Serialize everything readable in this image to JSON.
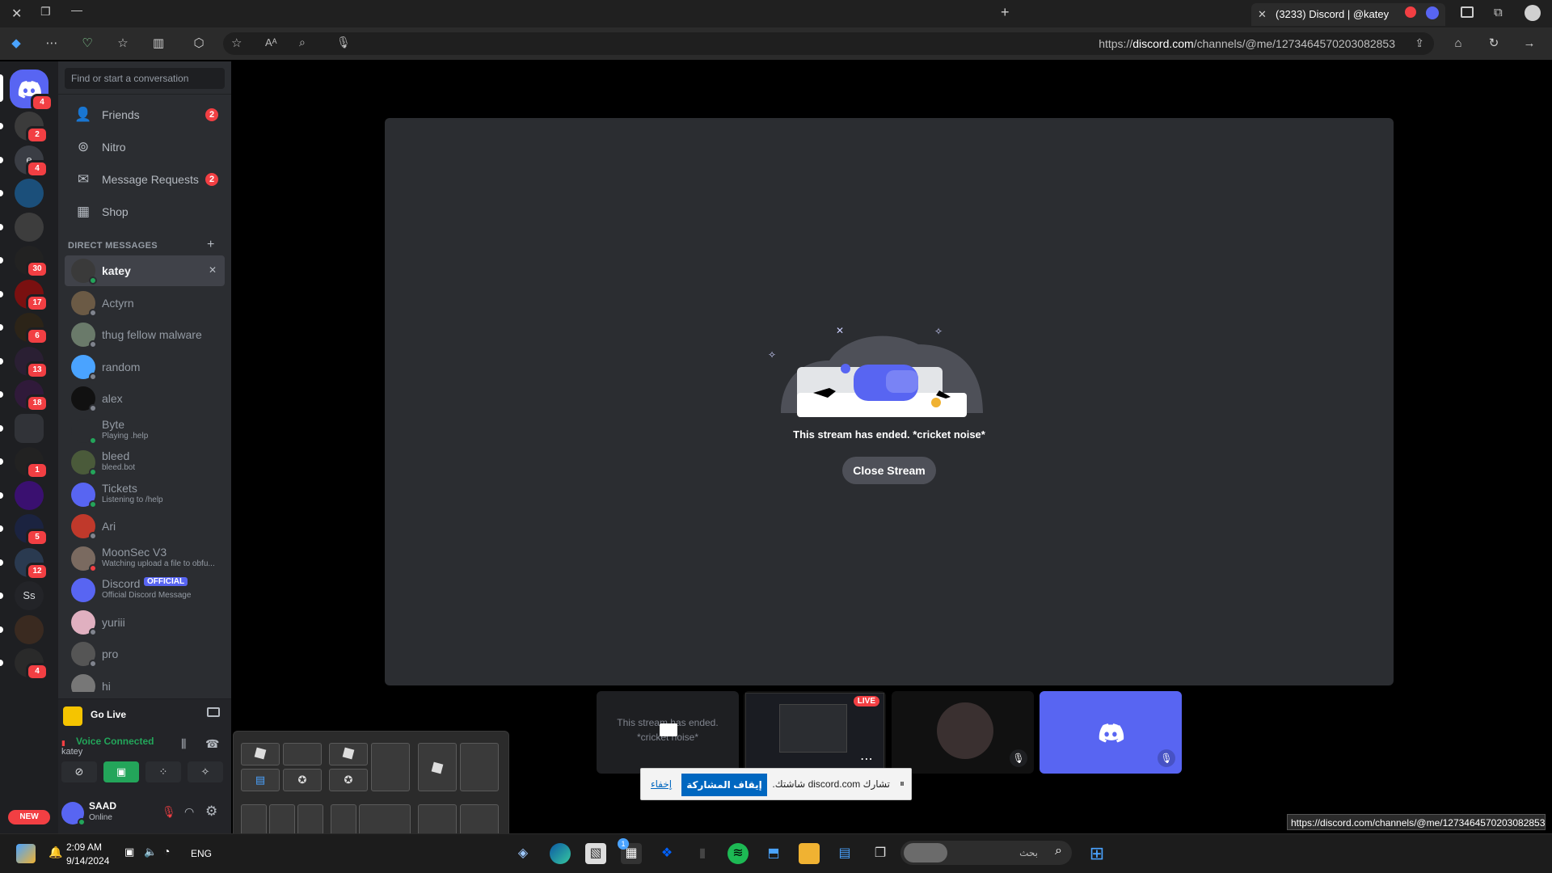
{
  "browser": {
    "tab_title": "(3233) Discord | @katey",
    "url_prefix": "https://",
    "url_host": "discord.com",
    "url_path": "/channels/@me/1273464570203082853",
    "status_url": "https://discord.com/channels/@me/1273464570203082853"
  },
  "guilds": {
    "home_badge": "4",
    "items": [
      {
        "badge": "2"
      },
      {
        "letter": "e",
        "badge": "4"
      },
      {
        "badge": ""
      },
      {
        "badge": ""
      },
      {
        "badge": "30"
      },
      {
        "badge": "17"
      },
      {
        "badge": "6"
      },
      {
        "badge": "13"
      },
      {
        "badge": "18"
      },
      {
        "badge": ""
      },
      {
        "badge": "1"
      },
      {
        "badge": ""
      },
      {
        "badge": "5"
      },
      {
        "badge": "12"
      },
      {
        "letter": "Ss",
        "badge": ""
      },
      {
        "badge": ""
      },
      {
        "badge": "4"
      }
    ],
    "new_label": "NEW"
  },
  "sidebar": {
    "search_placeholder": "Find or start a conversation",
    "nav": [
      {
        "label": "Friends",
        "badge": "2"
      },
      {
        "label": "Nitro",
        "badge": ""
      },
      {
        "label": "Message Requests",
        "badge": "2"
      },
      {
        "label": "Shop",
        "badge": ""
      }
    ],
    "dm_header": "DIRECT MESSAGES",
    "dms": [
      {
        "name": "katey",
        "sub": ""
      },
      {
        "name": "Actyrn",
        "sub": ""
      },
      {
        "name": "thug fellow malware",
        "sub": ""
      },
      {
        "name": "random",
        "sub": ""
      },
      {
        "name": "alex",
        "sub": ""
      },
      {
        "name": "Byte",
        "sub": "Playing .help"
      },
      {
        "name": "bleed",
        "sub": "bleed.bot"
      },
      {
        "name": "Tickets",
        "sub": "Listening to /help"
      },
      {
        "name": "Ari",
        "sub": ""
      },
      {
        "name": "MoonSec V3",
        "sub": "Watching upload a file to obfu..."
      },
      {
        "name": "Discord",
        "sub": "Official Discord Message",
        "tag": "OFFICIAL"
      },
      {
        "name": "yuriii",
        "sub": ""
      },
      {
        "name": "pro",
        "sub": ""
      },
      {
        "name": "hi",
        "sub": ""
      }
    ],
    "go_live": "Go Live",
    "voice_status": "Voice Connected",
    "voice_channel": "katey",
    "user_name": "SAAD",
    "user_status": "Online"
  },
  "stream": {
    "ended_text": "This stream has ended. *cricket noise*",
    "close_button": "Close Stream",
    "tile_text": "This stream has ended. *cricket noise*",
    "live_badge": "LIVE"
  },
  "share_banner": {
    "text": "تشارك discord.com شاشتك.",
    "stop_button": "إيقاف المشاركة",
    "hide_link": "إخفاء"
  },
  "taskbar": {
    "time": "2:09 AM",
    "date": "9/14/2024",
    "lang": "ENG",
    "search_placeholder": "بحث",
    "store_badge": "1"
  },
  "colors": {
    "blurple": "#5865f2",
    "red": "#f23f43",
    "green": "#23a55a"
  }
}
